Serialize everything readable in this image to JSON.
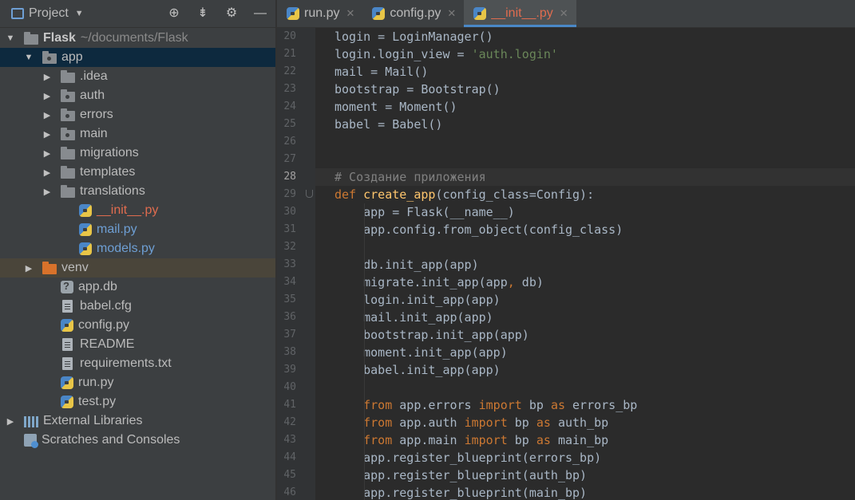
{
  "project_panel": {
    "title": "Project",
    "tools": [
      "crosshair-icon",
      "collapse-icon",
      "gear-icon",
      "minimize-icon"
    ],
    "tree": [
      {
        "indent": 0,
        "arrow": "▼",
        "icon": "folder",
        "label": "Flask",
        "path": "~/documents/Flask",
        "style": "bold"
      },
      {
        "indent": 1,
        "arrow": "▼",
        "icon": "folder-pkg",
        "label": "app",
        "selected": true
      },
      {
        "indent": 2,
        "arrow": "▶",
        "icon": "folder",
        "label": ".idea"
      },
      {
        "indent": 2,
        "arrow": "▶",
        "icon": "folder-pkg",
        "label": "auth"
      },
      {
        "indent": 2,
        "arrow": "▶",
        "icon": "folder-pkg",
        "label": "errors"
      },
      {
        "indent": 2,
        "arrow": "▶",
        "icon": "folder-pkg",
        "label": "main"
      },
      {
        "indent": 2,
        "arrow": "▶",
        "icon": "folder",
        "label": "migrations"
      },
      {
        "indent": 2,
        "arrow": "▶",
        "icon": "folder",
        "label": "templates"
      },
      {
        "indent": 2,
        "arrow": "▶",
        "icon": "folder",
        "label": "translations"
      },
      {
        "indent": 3,
        "arrow": "",
        "icon": "python",
        "label": "__init__.py",
        "style": "init"
      },
      {
        "indent": 3,
        "arrow": "",
        "icon": "python",
        "label": "mail.py",
        "style": "modified"
      },
      {
        "indent": 3,
        "arrow": "",
        "icon": "python",
        "label": "models.py",
        "style": "modified"
      },
      {
        "indent": 1,
        "arrow": "▶",
        "icon": "folder-orange",
        "label": "venv",
        "venv": true
      },
      {
        "indent": 2,
        "arrow": "",
        "icon": "db",
        "label": "app.db"
      },
      {
        "indent": 2,
        "arrow": "",
        "icon": "file",
        "label": "babel.cfg"
      },
      {
        "indent": 2,
        "arrow": "",
        "icon": "python",
        "label": "config.py"
      },
      {
        "indent": 2,
        "arrow": "",
        "icon": "file",
        "label": "README"
      },
      {
        "indent": 2,
        "arrow": "",
        "icon": "file",
        "label": "requirements.txt"
      },
      {
        "indent": 2,
        "arrow": "",
        "icon": "python",
        "label": "run.py"
      },
      {
        "indent": 2,
        "arrow": "",
        "icon": "python",
        "label": "test.py"
      },
      {
        "indent": 0,
        "arrow": "▶",
        "icon": "libs",
        "label": "External Libraries"
      },
      {
        "indent": 0,
        "arrow": "",
        "icon": "scratch",
        "label": "Scratches and Consoles"
      }
    ]
  },
  "tabs": [
    {
      "label": "run.py",
      "active": false,
      "style": ""
    },
    {
      "label": "config.py",
      "active": false,
      "style": ""
    },
    {
      "label": "__init__.py",
      "active": true,
      "style": "init"
    }
  ],
  "editor": {
    "current_line": 28,
    "lines": [
      {
        "n": 20,
        "tokens": [
          [
            "",
            "login = LoginManager()"
          ]
        ]
      },
      {
        "n": 21,
        "tokens": [
          [
            "",
            "login.login_view = "
          ],
          [
            "str",
            "'auth.login'"
          ]
        ]
      },
      {
        "n": 22,
        "tokens": [
          [
            "",
            "mail = Mail()"
          ]
        ]
      },
      {
        "n": 23,
        "tokens": [
          [
            "",
            "bootstrap = Bootstrap()"
          ]
        ]
      },
      {
        "n": 24,
        "tokens": [
          [
            "",
            "moment = Moment()"
          ]
        ]
      },
      {
        "n": 25,
        "tokens": [
          [
            "",
            "babel = Babel()"
          ]
        ]
      },
      {
        "n": 26,
        "tokens": []
      },
      {
        "n": 27,
        "tokens": []
      },
      {
        "n": 28,
        "tokens": [
          [
            "cm",
            "# Создание приложения"
          ]
        ]
      },
      {
        "n": 29,
        "fold": true,
        "tokens": [
          [
            "kw",
            "def "
          ],
          [
            "fn",
            "create_app"
          ],
          [
            "",
            "(config_class=Config):"
          ]
        ]
      },
      {
        "n": 30,
        "tokens": [
          [
            "",
            "    app = Flask(__name__)"
          ]
        ]
      },
      {
        "n": 31,
        "tokens": [
          [
            "",
            "    app.config.from_object(config_class)"
          ]
        ]
      },
      {
        "n": 32,
        "tokens": []
      },
      {
        "n": 33,
        "tokens": [
          [
            "",
            "    db.init_app(app)"
          ]
        ]
      },
      {
        "n": 34,
        "tokens": [
          [
            "",
            "    migrate.init_app(app"
          ],
          [
            "kw",
            ","
          ],
          [
            "",
            " db)"
          ]
        ]
      },
      {
        "n": 35,
        "tokens": [
          [
            "",
            "    login.init_app(app)"
          ]
        ]
      },
      {
        "n": 36,
        "tokens": [
          [
            "",
            "    mail.init_app(app)"
          ]
        ]
      },
      {
        "n": 37,
        "tokens": [
          [
            "",
            "    bootstrap.init_app(app)"
          ]
        ]
      },
      {
        "n": 38,
        "tokens": [
          [
            "",
            "    moment.init_app(app)"
          ]
        ]
      },
      {
        "n": 39,
        "tokens": [
          [
            "",
            "    babel.init_app(app)"
          ]
        ]
      },
      {
        "n": 40,
        "tokens": []
      },
      {
        "n": 41,
        "tokens": [
          [
            "kw",
            "    from "
          ],
          [
            "",
            "app.errors "
          ],
          [
            "kw",
            "import "
          ],
          [
            "",
            "bp "
          ],
          [
            "kw",
            "as "
          ],
          [
            "",
            "errors_bp"
          ]
        ]
      },
      {
        "n": 42,
        "tokens": [
          [
            "kw",
            "    from "
          ],
          [
            "",
            "app.auth "
          ],
          [
            "kw",
            "import "
          ],
          [
            "",
            "bp "
          ],
          [
            "kw",
            "as "
          ],
          [
            "",
            "auth_bp"
          ]
        ]
      },
      {
        "n": 43,
        "tokens": [
          [
            "kw",
            "    from "
          ],
          [
            "",
            "app.main "
          ],
          [
            "kw",
            "import "
          ],
          [
            "",
            "bp "
          ],
          [
            "kw",
            "as "
          ],
          [
            "",
            "main_bp"
          ]
        ]
      },
      {
        "n": 44,
        "tokens": [
          [
            "",
            "    app.register_blueprint(errors_bp)"
          ]
        ]
      },
      {
        "n": 45,
        "tokens": [
          [
            "",
            "    app.register_blueprint(auth_bp)"
          ]
        ]
      },
      {
        "n": 46,
        "tokens": [
          [
            "",
            "    app.register_blueprint(main_bp)"
          ]
        ]
      }
    ]
  }
}
